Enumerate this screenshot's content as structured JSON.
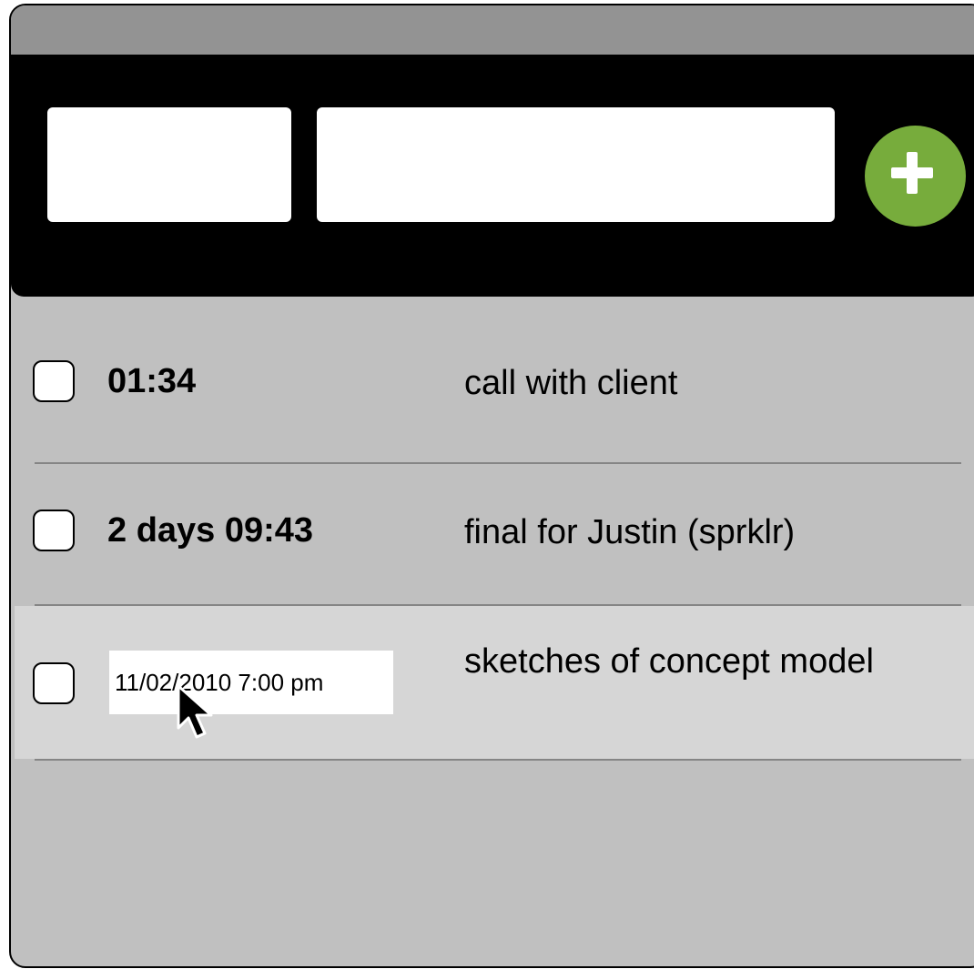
{
  "toolbar": {
    "when_value": "",
    "task_value": "",
    "add_icon": "plus-icon",
    "add_color": "#77ac3c"
  },
  "tasks": [
    {
      "time": "01:34",
      "label": "call with client",
      "checked": false
    },
    {
      "time": "2 days 09:43",
      "label": "final for Justin (sprklr)",
      "checked": false
    },
    {
      "time_edit_value": "11/02/2010 7:00 pm",
      "label": "sketches of concept model",
      "checked": false,
      "editing": true
    }
  ]
}
